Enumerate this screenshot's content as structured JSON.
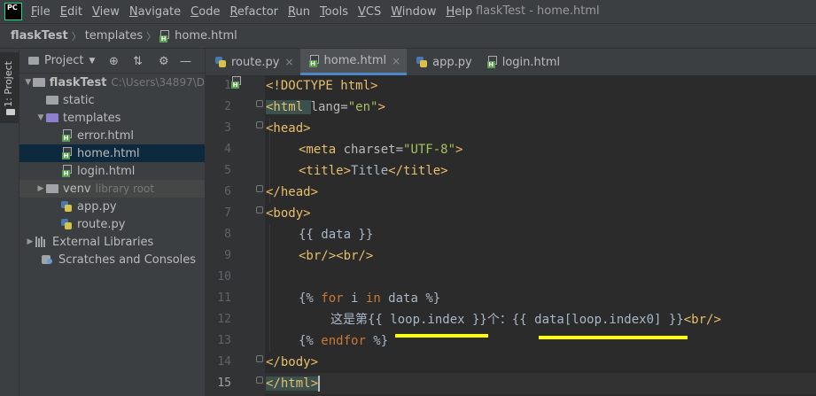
{
  "menubar": {
    "logo_text": "PC",
    "items": [
      {
        "label": "File",
        "mnemonic": "F",
        "rest": "ile"
      },
      {
        "label": "Edit",
        "mnemonic": "E",
        "rest": "dit"
      },
      {
        "label": "View",
        "mnemonic": "V",
        "rest": "iew"
      },
      {
        "label": "Navigate",
        "mnemonic": "N",
        "rest": "avigate"
      },
      {
        "label": "Code",
        "mnemonic": "C",
        "rest": "ode"
      },
      {
        "label": "Refactor",
        "mnemonic": "R",
        "rest": "efactor"
      },
      {
        "label": "Run",
        "mnemonic": "R",
        "rest": "un"
      },
      {
        "label": "Tools",
        "mnemonic": "T",
        "rest": "ools"
      },
      {
        "label": "VCS",
        "mnemonic": "V",
        "rest": "CS"
      },
      {
        "label": "Window",
        "mnemonic": "W",
        "rest": "indow"
      },
      {
        "label": "Help",
        "mnemonic": "H",
        "rest": "elp"
      }
    ],
    "window_title": "flaskTest - home.html"
  },
  "breadcrumb": {
    "project": "flaskTest",
    "folder": "templates",
    "file": "home.html"
  },
  "left_strip": {
    "tab_label": "1: Project"
  },
  "project_panel": {
    "title": "Project",
    "tree": {
      "root_name": "flaskTest",
      "root_path": "C:\\Users\\34897\\D",
      "static": "static",
      "templates": "templates",
      "error": "error.html",
      "home": "home.html",
      "login": "login.html",
      "venv": "venv",
      "venv_note": "library root",
      "app": "app.py",
      "route": "route.py",
      "external": "External Libraries",
      "scratches": "Scratches and Consoles"
    }
  },
  "tabs": [
    {
      "label": "route.py",
      "type": "py",
      "active": false
    },
    {
      "label": "home.html",
      "type": "html",
      "active": true
    },
    {
      "label": "app.py",
      "type": "py",
      "active": false
    },
    {
      "label": "login.html",
      "type": "html",
      "active": false
    }
  ],
  "editor": {
    "line_numbers": [
      "1",
      "2",
      "3",
      "4",
      "5",
      "6",
      "7",
      "8",
      "9",
      "10",
      "11",
      "12",
      "13",
      "14",
      "15"
    ],
    "current_line": "15",
    "code": {
      "l1": "<!DOCTYPE html>",
      "l2_tag_open": "<html ",
      "l2_attr": "lang=",
      "l2_val": "\"en\"",
      "l2_close": ">",
      "l3": "<head>",
      "l4_tag": "<meta ",
      "l4_attr": "charset=",
      "l4_val": "\"UTF-8\"",
      "l4_close": ">",
      "l5_open": "<title>",
      "l5_text": "Title",
      "l5_close": "</title>",
      "l6": "</head>",
      "l7": "<body>",
      "l8": "{{ data }}",
      "l9": "<br/><br/>",
      "l11_a": "{% ",
      "l11_for": "for",
      "l11_b": " i ",
      "l11_in": "in",
      "l11_c": " data %}",
      "l12_text1": "这是第",
      "l12_expr1": "{{ loop.index }}",
      "l12_text2": "个：",
      "l12_expr2": "{{ data[loop.index0] }}",
      "l12_br": "<br/>",
      "l13_a": "{% ",
      "l13_endfor": "endfor",
      "l13_b": " %}",
      "l14": "</body>",
      "l15": "</html>"
    }
  },
  "colors": {
    "annotation_underline": "#ffff00",
    "tag": "#e8bf6a",
    "string": "#a5c25c",
    "keyword": "#cc7832",
    "background": "#2b2b2b"
  }
}
